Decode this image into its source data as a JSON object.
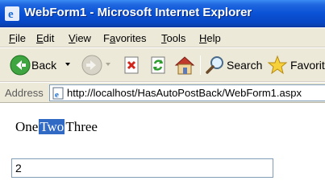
{
  "window": {
    "title": "WebForm1 - Microsoft Internet Explorer"
  },
  "menu": {
    "items": [
      {
        "label": "File",
        "accel": "F"
      },
      {
        "label": "Edit",
        "accel": "E"
      },
      {
        "label": "View",
        "accel": "V"
      },
      {
        "label": "Favorites",
        "accel": "a"
      },
      {
        "label": "Tools",
        "accel": "T"
      },
      {
        "label": "Help",
        "accel": "H"
      }
    ]
  },
  "toolbar": {
    "back_label": "Back",
    "search_label": "Search",
    "favorites_label": "Favorit"
  },
  "address": {
    "label": "Address",
    "url": "http://localhost/HasAutoPostBack/WebForm1.aspx"
  },
  "page": {
    "options": [
      "One",
      "Two",
      "Three"
    ],
    "selected_option": "Two",
    "textbox_value": "2"
  },
  "colors": {
    "titlebar": "#0a52d6",
    "selection": "#316ac5",
    "chrome": "#ece9d8"
  }
}
